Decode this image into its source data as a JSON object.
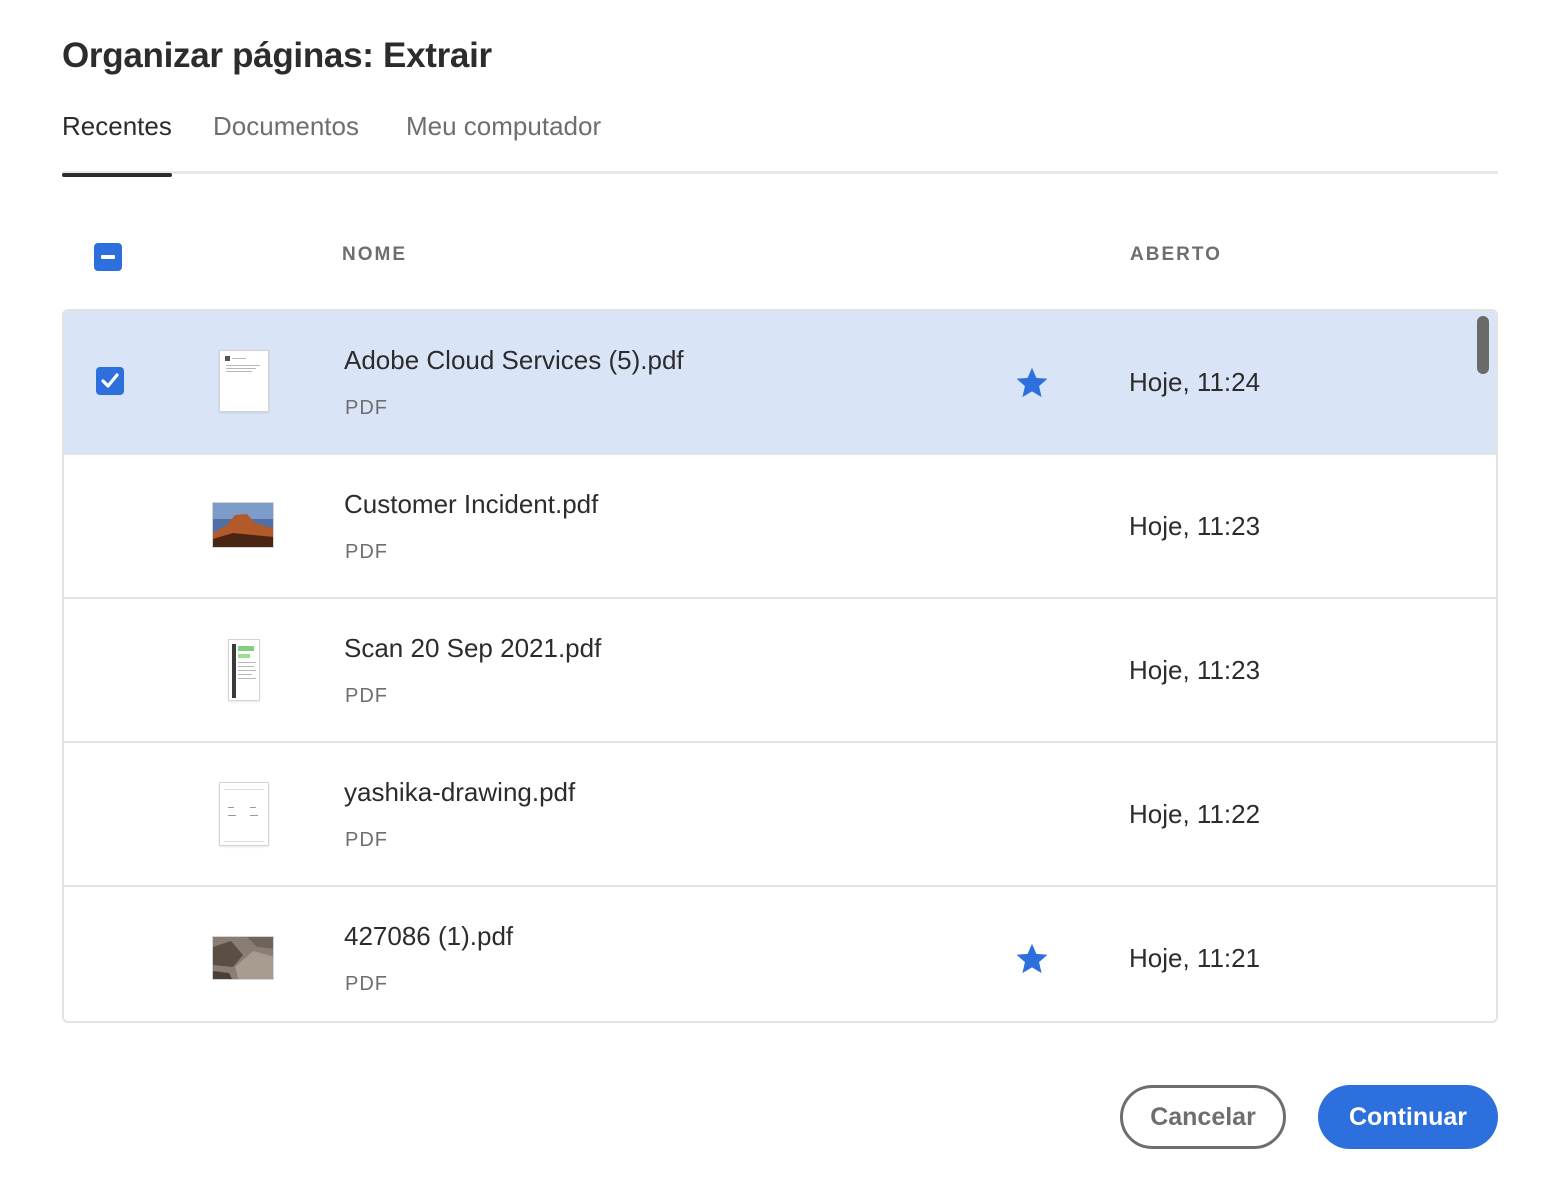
{
  "dialog": {
    "title": "Organizar páginas: Extrair"
  },
  "tabs": [
    {
      "label": "Recentes",
      "active": true
    },
    {
      "label": "Documentos",
      "active": false
    },
    {
      "label": "Meu computador",
      "active": false
    }
  ],
  "columns": {
    "name": "NOME",
    "opened": "ABERTO"
  },
  "header_checkbox": {
    "state": "indeterminate"
  },
  "files": [
    {
      "name": "Adobe Cloud Services (5).pdf",
      "type": "PDF",
      "opened": "Hoje, 11:24",
      "starred": true,
      "selected": true,
      "thumbnail": "document-page"
    },
    {
      "name": "Customer Incident.pdf",
      "type": "PDF",
      "opened": "Hoje, 11:23",
      "starred": false,
      "selected": false,
      "thumbnail": "landscape-photo"
    },
    {
      "name": "Scan 20 Sep 2021.pdf",
      "type": "PDF",
      "opened": "Hoje, 11:23",
      "starred": false,
      "selected": false,
      "thumbnail": "scanned-page"
    },
    {
      "name": "yashika-drawing.pdf",
      "type": "PDF",
      "opened": "Hoje, 11:22",
      "starred": false,
      "selected": false,
      "thumbnail": "drawing-page"
    },
    {
      "name": "427086 (1).pdf",
      "type": "PDF",
      "opened": "Hoje, 11:21",
      "starred": true,
      "selected": false,
      "thumbnail": "stone-photo"
    }
  ],
  "buttons": {
    "cancel": "Cancelar",
    "continue": "Continuar"
  },
  "colors": {
    "accent": "#2d6fdd",
    "selected_row": "#d9e5f7",
    "star": "#2d6fdd"
  },
  "icons": {
    "star": "star-icon",
    "checkmark": "checkmark-icon",
    "indeterminate": "minus-icon"
  }
}
